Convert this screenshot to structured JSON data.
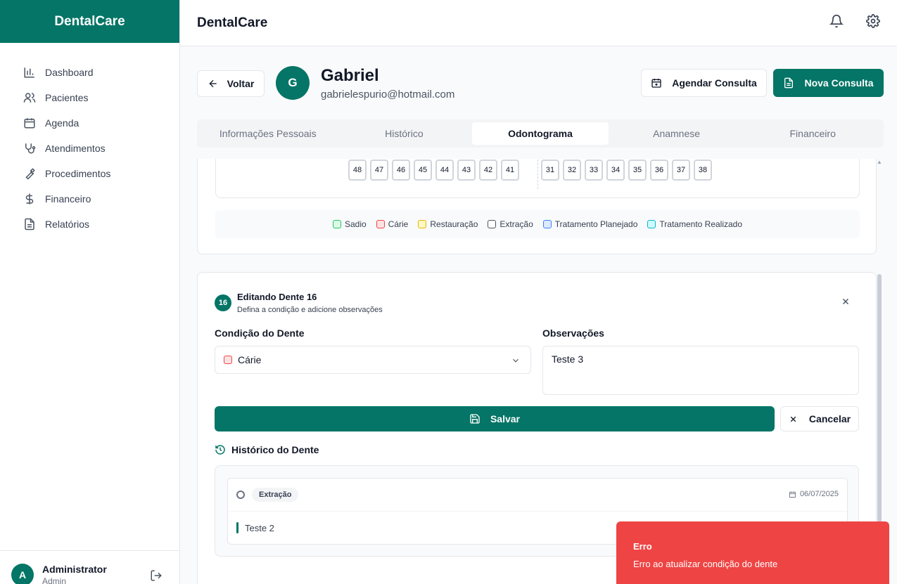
{
  "sidebar": {
    "brand": "DentalCare",
    "items": [
      {
        "label": "Dashboard",
        "icon": "bar-chart-icon"
      },
      {
        "label": "Pacientes",
        "icon": "users-icon"
      },
      {
        "label": "Agenda",
        "icon": "calendar-icon"
      },
      {
        "label": "Atendimentos",
        "icon": "stethoscope-icon"
      },
      {
        "label": "Procedimentos",
        "icon": "wrench-icon"
      },
      {
        "label": "Financeiro",
        "icon": "dollar-icon"
      },
      {
        "label": "Relatórios",
        "icon": "file-text-icon"
      }
    ],
    "user": {
      "initial": "A",
      "name": "Administrator",
      "role": "Admin"
    }
  },
  "topbar": {
    "title": "DentalCare"
  },
  "patient": {
    "back_label": "Voltar",
    "initial": "G",
    "name": "Gabriel",
    "email": "gabrielespurio@hotmail.com",
    "schedule_label": "Agendar Consulta",
    "new_label": "Nova Consulta"
  },
  "tabs": [
    {
      "label": "Informações Pessoais",
      "active": false
    },
    {
      "label": "Histórico",
      "active": false
    },
    {
      "label": "Odontograma",
      "active": true
    },
    {
      "label": "Anamnese",
      "active": false
    },
    {
      "label": "Financeiro",
      "active": false
    }
  ],
  "odontogram": {
    "lower_right": [
      "48",
      "47",
      "46",
      "45",
      "44",
      "43",
      "42",
      "41"
    ],
    "lower_left": [
      "31",
      "32",
      "33",
      "34",
      "35",
      "36",
      "37",
      "38"
    ],
    "legend": [
      {
        "label": "Sadio",
        "fill": "#dcfce7",
        "border": "#22c55e"
      },
      {
        "label": "Cárie",
        "fill": "#fee2e2",
        "border": "#ef4444"
      },
      {
        "label": "Restauração",
        "fill": "#fef9c3",
        "border": "#eab308"
      },
      {
        "label": "Extração",
        "fill": "#ffffff",
        "border": "#4b5563"
      },
      {
        "label": "Tratamento Planejado",
        "fill": "#dbeafe",
        "border": "#3b82f6"
      },
      {
        "label": "Tratamento Realizado",
        "fill": "#cffafe",
        "border": "#06b6d4"
      }
    ]
  },
  "editor": {
    "tooth_number": "16",
    "title": "Editando Dente 16",
    "subtitle": "Defina a condição e adicione observações",
    "condition_label": "Condição do Dente",
    "condition_value": "Cárie",
    "notes_label": "Observações",
    "notes_value": "Teste 3",
    "save_label": "Salvar",
    "cancel_label": "Cancelar",
    "history_title": "Histórico do Dente",
    "history": [
      {
        "condition": "Extração",
        "date": "06/07/2025",
        "note": "Teste 2"
      }
    ]
  },
  "toast": {
    "title": "Erro",
    "message": "Erro ao atualizar condição do dente",
    "color": "#ef4444"
  },
  "colors": {
    "primary": "#047566"
  }
}
